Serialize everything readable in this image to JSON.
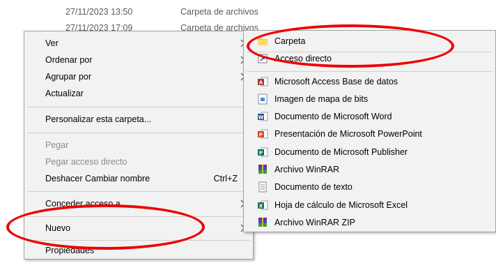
{
  "background_rows": [
    {
      "date": "27/11/2023 13:50",
      "type": "Carpeta de archivos"
    },
    {
      "date": "27/11/2023 17:09",
      "type": "Carpeta de archivos"
    }
  ],
  "context_menu": {
    "items": [
      {
        "label": "Ver",
        "submenu": true
      },
      {
        "label": "Ordenar por",
        "submenu": true
      },
      {
        "label": "Agrupar por",
        "submenu": true
      },
      {
        "label": "Actualizar"
      },
      {
        "label": "Personalizar esta carpeta..."
      },
      {
        "label": "Pegar",
        "disabled": true
      },
      {
        "label": "Pegar acceso directo",
        "disabled": true
      },
      {
        "label": "Deshacer Cambiar nombre",
        "shortcut": "Ctrl+Z"
      },
      {
        "label": "Conceder acceso a",
        "submenu": true
      },
      {
        "label": "Nuevo",
        "submenu": true
      },
      {
        "label": "Propiedades"
      }
    ]
  },
  "submenu_new": {
    "items": [
      {
        "label": "Carpeta",
        "icon": "folder-icon"
      },
      {
        "label": "Acceso directo",
        "icon": "shortcut-icon"
      },
      {
        "label": "Microsoft Access Base de datos",
        "icon": "access-icon"
      },
      {
        "label": "Imagen de mapa de bits",
        "icon": "bitmap-icon"
      },
      {
        "label": "Documento de Microsoft Word",
        "icon": "word-icon"
      },
      {
        "label": "Presentación de Microsoft PowerPoint",
        "icon": "powerpoint-icon"
      },
      {
        "label": "Documento de Microsoft Publisher",
        "icon": "publisher-icon"
      },
      {
        "label": "Archivo WinRAR",
        "icon": "winrar-icon"
      },
      {
        "label": "Documento de texto",
        "icon": "text-document-icon"
      },
      {
        "label": "Hoja de cálculo de Microsoft Excel",
        "icon": "excel-icon"
      },
      {
        "label": "Archivo WinRAR ZIP",
        "icon": "winrar-zip-icon"
      }
    ]
  },
  "colors": {
    "menu_bg": "#f2f2f2",
    "annotation": "#ee0000",
    "folder": "#f5c542",
    "access": "#a4373a",
    "word": "#2b579a",
    "powerpoint": "#d24726",
    "publisher": "#077568",
    "excel": "#217346"
  }
}
